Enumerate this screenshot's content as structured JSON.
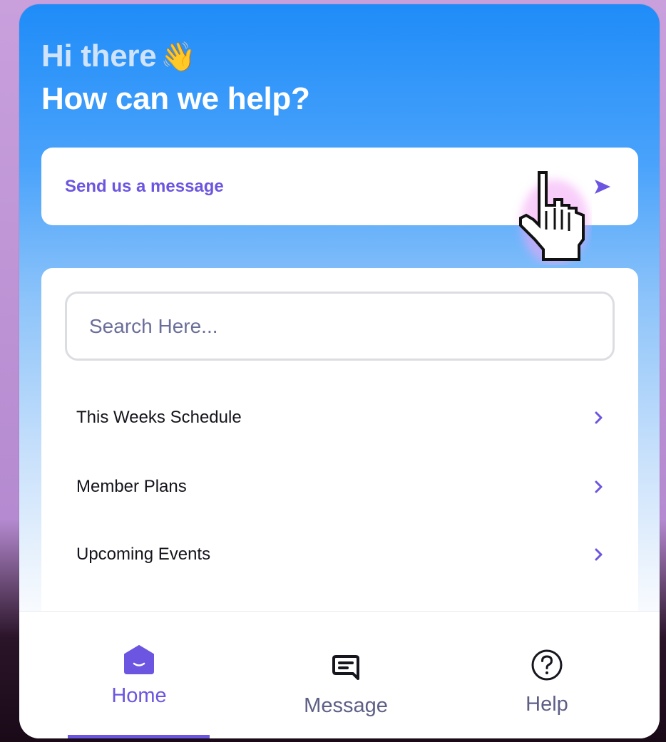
{
  "header": {
    "greeting": "Hi there",
    "greeting_emoji": "👋",
    "headline": "How can we help?"
  },
  "send_message": {
    "label": "Send us a message",
    "icon": "send-arrow-icon"
  },
  "search": {
    "placeholder": "Search Here..."
  },
  "list": [
    {
      "label": "This Weeks Schedule",
      "icon": "chevron-right-icon"
    },
    {
      "label": "Member Plans",
      "icon": "chevron-right-icon"
    },
    {
      "label": "Upcoming Events",
      "icon": "chevron-right-icon"
    }
  ],
  "tabs": [
    {
      "label": "Home",
      "icon": "home-icon",
      "active": true
    },
    {
      "label": "Message",
      "icon": "message-icon",
      "active": false
    },
    {
      "label": "Help",
      "icon": "help-icon",
      "active": false
    }
  ],
  "colors": {
    "accent": "#6c55e0",
    "header_blue": "#1f8cf8",
    "inactive_tab": "#5d5f86"
  }
}
